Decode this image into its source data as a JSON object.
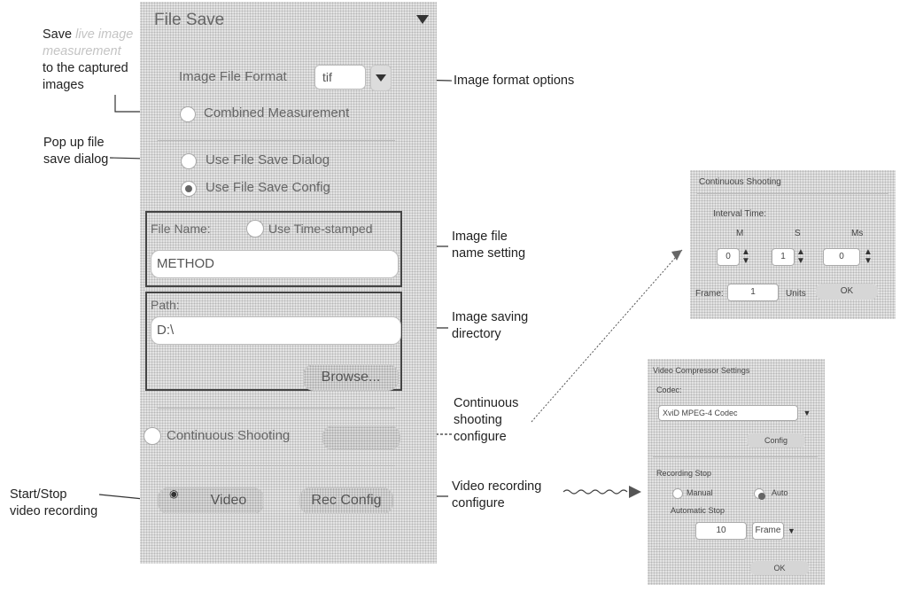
{
  "annotations": {
    "save_line1": "Save",
    "save_faded1": "live image",
    "save_faded2": "measurement",
    "save_line3": "to the captured",
    "save_line4": "images",
    "image_format_options": "Image format options",
    "popup_line1": "Pop up file",
    "popup_line2": "save dialog",
    "image_file_line1": "Image file",
    "image_file_line2": "name setting",
    "saving_line1": "Image saving",
    "saving_line2": "directory",
    "cont_line1": "Continuous",
    "cont_line2": "shooting",
    "cont_line3": "configure",
    "video_cfg_line1": "Video recording",
    "video_cfg_line2": "configure",
    "startstop_line1": "Start/Stop",
    "startstop_line2": "video recording"
  },
  "panel": {
    "title": "File Save",
    "image_format_label": "Image File Format",
    "image_format_value": "tif",
    "combined_measurement": "Combined Measurement",
    "use_file_save_dialog": "Use File Save Dialog",
    "use_file_save_config": "Use File Save Config",
    "file_name_label": "File Name:",
    "use_time_stamped": "Use Time-stamped",
    "file_name_value": "METHOD",
    "path_label": "Path:",
    "path_value": "D:\\",
    "browse_button": "Browse...",
    "continuous_shooting": "Continuous Shooting",
    "video_button": "Video",
    "rec_config_button": "Rec Config"
  },
  "continuous_dialog": {
    "title": "Continuous Shooting",
    "interval_label": "Interval Time:",
    "col_m": "M",
    "col_s": "S",
    "col_ms": "Ms",
    "m_value": "0",
    "s_value": "1",
    "ms_value": "0",
    "frame_label": "Frame:",
    "frame_value": "1",
    "units_label": "Units",
    "ok_button": "OK"
  },
  "video_dialog": {
    "title": "Video Compressor Settings",
    "codec_label": "Codec:",
    "codec_value": "XviD MPEG-4 Codec",
    "config_button": "Config",
    "recording_stop_label": "Recording Stop",
    "manual_label": "Manual",
    "auto_label": "Auto",
    "automatic_stop_label": "Automatic Stop",
    "automatic_stop_value": "10",
    "unit_value": "Frame",
    "ok_button": "OK"
  }
}
